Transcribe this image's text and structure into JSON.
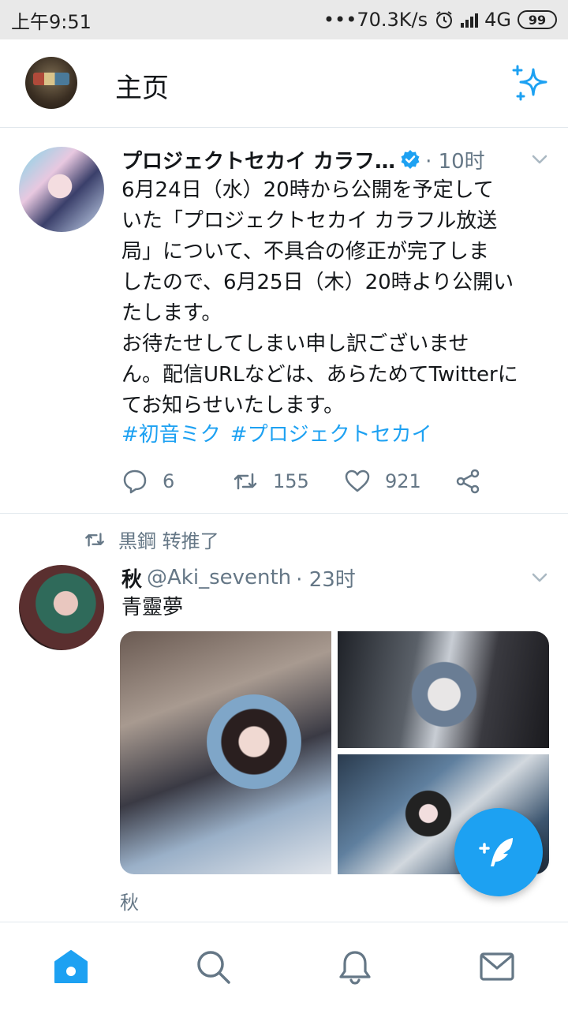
{
  "status_bar": {
    "time": "上午9:51",
    "net_speed": "•••70.3K/s",
    "network": "4G",
    "battery": "99"
  },
  "header": {
    "title": "主页"
  },
  "tweets": [
    {
      "name": "プロジェクトセカイ カラフ…",
      "verified": true,
      "time": "· 10时",
      "text": "6月24日（水）20時から公開を予定して\nいた「プロジェクトセカイ カラフル放送\n局」について、不具合の修正が完了しま\nしたので、6月25日（木）20時より公開い\nたします。\nお待たせしてしまい申し訳ございませ\nん。配信URLなどは、あらためてTwitterに\nてお知らせいたします。",
      "hashtags": [
        "#初音ミク",
        "#プロジェクトセカイ"
      ],
      "replies": "6",
      "retweets": "155",
      "likes": "921"
    },
    {
      "retweeted_by": "黒鋼 转推了",
      "name": "秋",
      "handle": "@Aki_seventh",
      "time": "· 23时",
      "text": "青靈夢",
      "media_caption": "秋"
    }
  ],
  "colors": {
    "accent": "#1da1f2",
    "secondary_text": "#657786",
    "divider": "#e1e8ed"
  },
  "icons": {
    "top_right": "sparkle-icon",
    "nav": [
      "home-icon",
      "search-icon",
      "bell-icon",
      "mail-icon"
    ],
    "fab": "compose-feather-icon"
  }
}
